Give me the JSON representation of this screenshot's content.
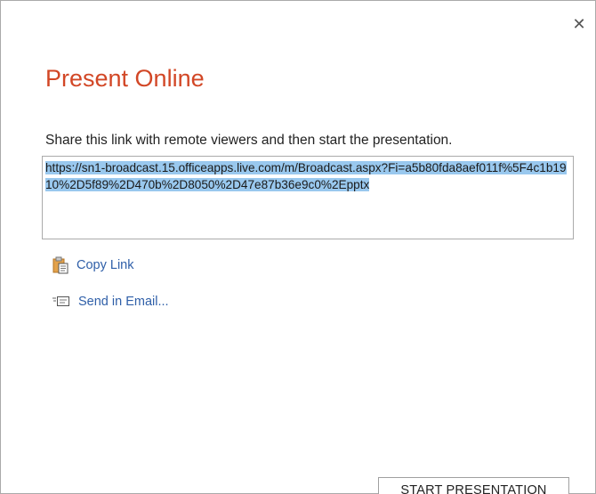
{
  "dialog": {
    "close_glyph": "✕",
    "title": "Present Online",
    "instruction": "Share this link with remote viewers and then start the presentation.",
    "broadcast_link": "https://sn1-broadcast.15.officeapps.live.com/m/Broadcast.aspx?Fi=a5b80fda8aef011f%5F4c1b1910%2D5f89%2D470b%2D8050%2D47e87b36e9c0%2Epptx",
    "actions": {
      "copy_link": "Copy Link",
      "send_email": "Send in Email..."
    },
    "start_button": "START PRESENTATION"
  },
  "colors": {
    "title": "#d24726",
    "action_link": "#2f5fa8",
    "selection_highlight": "#99c8ee"
  },
  "icons": {
    "close": "close-icon",
    "copy": "clipboard-icon",
    "email": "email-icon"
  }
}
